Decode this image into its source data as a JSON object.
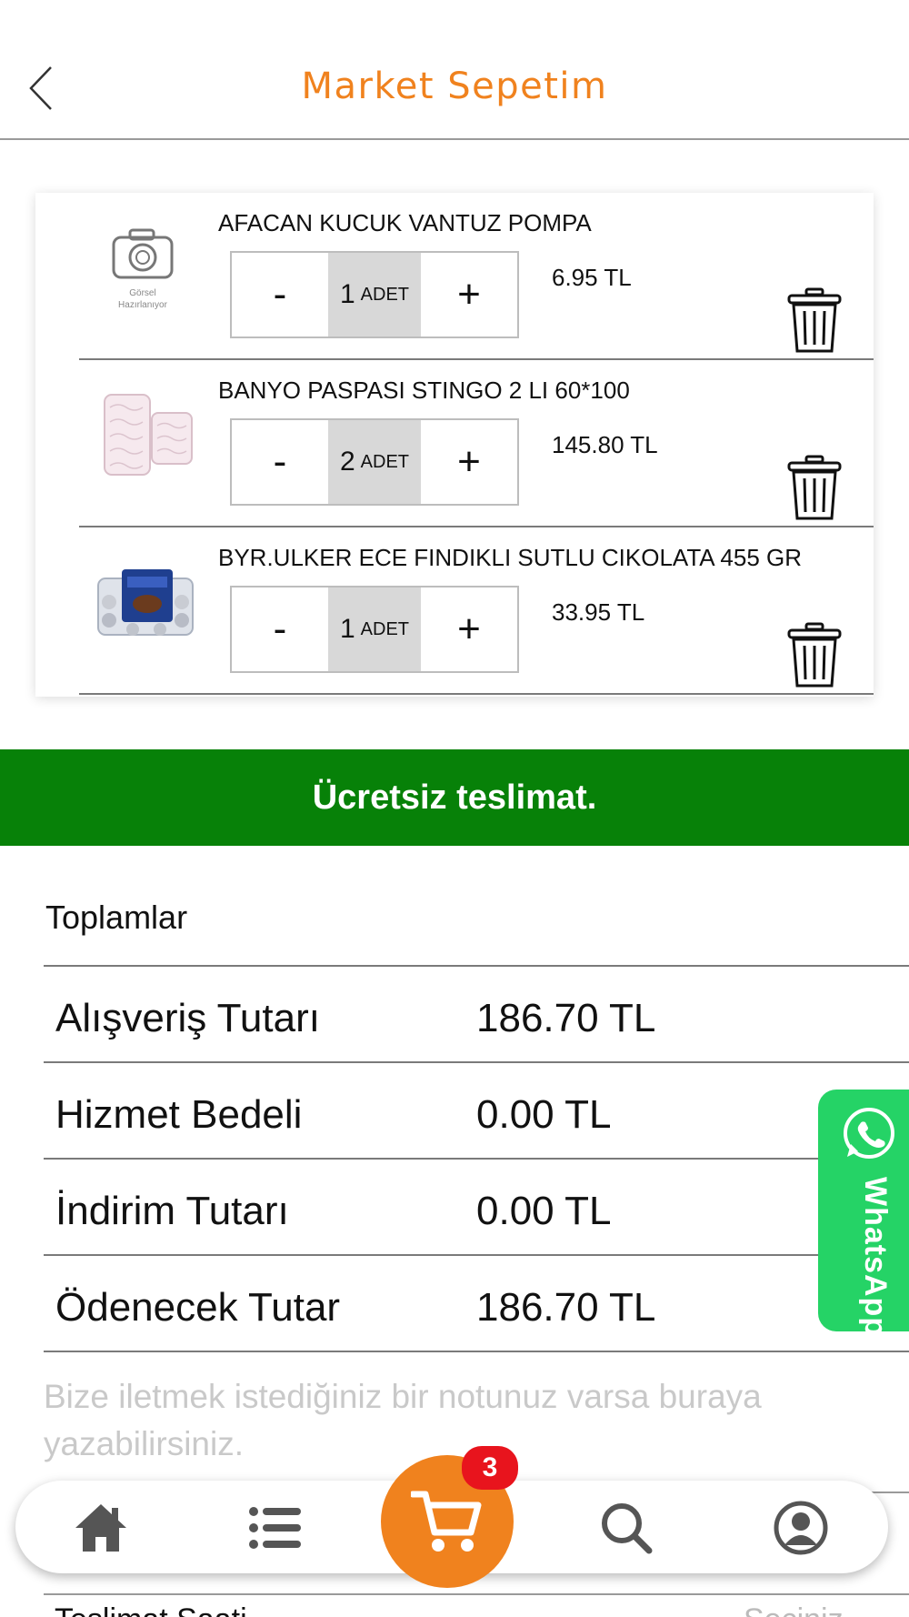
{
  "header": {
    "title": "Market Sepetim"
  },
  "cart": {
    "items": [
      {
        "name": "AFACAN KUCUK VANTUZ POMPA",
        "quantity": "1",
        "unit": "ADET",
        "price": "6.95 TL",
        "thumb_caption_1": "Görsel",
        "thumb_caption_2": "Hazırlanıyor"
      },
      {
        "name": "BANYO PASPASI STINGO 2 LI 60*100",
        "quantity": "2",
        "unit": "ADET",
        "price": "145.80 TL"
      },
      {
        "name": "BYR.ULKER ECE FINDIKLI SUTLU CIKOLATA 455 GR",
        "quantity": "1",
        "unit": "ADET",
        "price": "33.95 TL"
      }
    ],
    "minus_label": "-",
    "plus_label": "+"
  },
  "delivery": {
    "text": "Ücretsiz teslimat."
  },
  "totals": {
    "title": "Toplamlar",
    "rows": [
      {
        "label": "Alışveriş Tutarı",
        "value": "186.70 TL"
      },
      {
        "label": "Hizmet Bedeli",
        "value": "0.00 TL"
      },
      {
        "label": "İndirim Tutarı",
        "value": "0.00 TL"
      },
      {
        "label": "Ödenecek Tutar",
        "value": "186.70 TL"
      }
    ]
  },
  "note": {
    "placeholder": "Bize iletmek istediğiniz bir notunuz varsa buraya yazabilirsiniz."
  },
  "below": {
    "left_text": "Teslimat Saati",
    "right_text": "Seçiniz"
  },
  "whatsapp": {
    "label": "WhatsApp"
  },
  "bottom_nav": {
    "items": [
      "home-icon",
      "list-icon",
      "cart-icon",
      "search-icon",
      "user-icon"
    ],
    "cart_badge": "3"
  },
  "colors": {
    "accent": "#f0821e",
    "delivery_green": "#078108",
    "whatsapp_green": "#25d366",
    "badge_red": "#e8141d"
  }
}
